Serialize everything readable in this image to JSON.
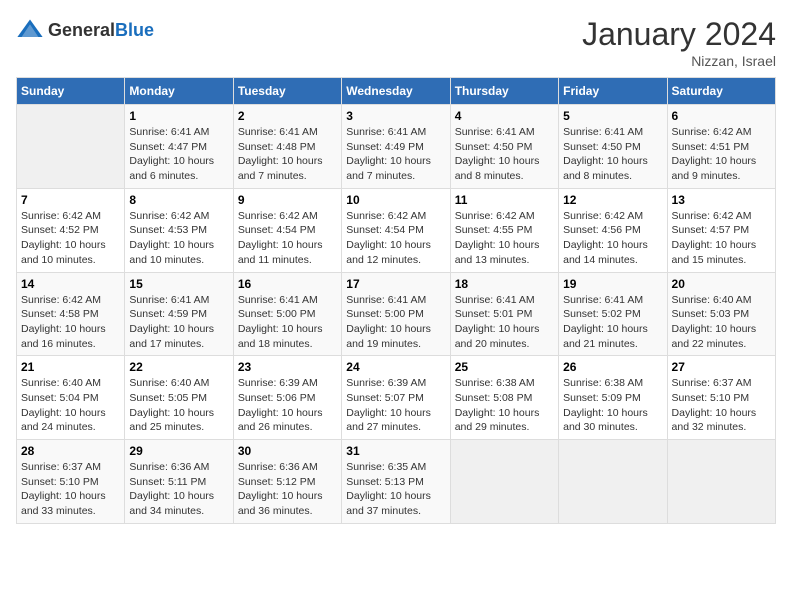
{
  "header": {
    "logo_general": "General",
    "logo_blue": "Blue",
    "month_title": "January 2024",
    "location": "Nizzan, Israel"
  },
  "days_of_week": [
    "Sunday",
    "Monday",
    "Tuesday",
    "Wednesday",
    "Thursday",
    "Friday",
    "Saturday"
  ],
  "weeks": [
    [
      {
        "day": "",
        "info": ""
      },
      {
        "day": "1",
        "info": "Sunrise: 6:41 AM\nSunset: 4:47 PM\nDaylight: 10 hours\nand 6 minutes."
      },
      {
        "day": "2",
        "info": "Sunrise: 6:41 AM\nSunset: 4:48 PM\nDaylight: 10 hours\nand 7 minutes."
      },
      {
        "day": "3",
        "info": "Sunrise: 6:41 AM\nSunset: 4:49 PM\nDaylight: 10 hours\nand 7 minutes."
      },
      {
        "day": "4",
        "info": "Sunrise: 6:41 AM\nSunset: 4:50 PM\nDaylight: 10 hours\nand 8 minutes."
      },
      {
        "day": "5",
        "info": "Sunrise: 6:41 AM\nSunset: 4:50 PM\nDaylight: 10 hours\nand 8 minutes."
      },
      {
        "day": "6",
        "info": "Sunrise: 6:42 AM\nSunset: 4:51 PM\nDaylight: 10 hours\nand 9 minutes."
      }
    ],
    [
      {
        "day": "7",
        "info": "Sunrise: 6:42 AM\nSunset: 4:52 PM\nDaylight: 10 hours\nand 10 minutes."
      },
      {
        "day": "8",
        "info": "Sunrise: 6:42 AM\nSunset: 4:53 PM\nDaylight: 10 hours\nand 10 minutes."
      },
      {
        "day": "9",
        "info": "Sunrise: 6:42 AM\nSunset: 4:54 PM\nDaylight: 10 hours\nand 11 minutes."
      },
      {
        "day": "10",
        "info": "Sunrise: 6:42 AM\nSunset: 4:54 PM\nDaylight: 10 hours\nand 12 minutes."
      },
      {
        "day": "11",
        "info": "Sunrise: 6:42 AM\nSunset: 4:55 PM\nDaylight: 10 hours\nand 13 minutes."
      },
      {
        "day": "12",
        "info": "Sunrise: 6:42 AM\nSunset: 4:56 PM\nDaylight: 10 hours\nand 14 minutes."
      },
      {
        "day": "13",
        "info": "Sunrise: 6:42 AM\nSunset: 4:57 PM\nDaylight: 10 hours\nand 15 minutes."
      }
    ],
    [
      {
        "day": "14",
        "info": "Sunrise: 6:42 AM\nSunset: 4:58 PM\nDaylight: 10 hours\nand 16 minutes."
      },
      {
        "day": "15",
        "info": "Sunrise: 6:41 AM\nSunset: 4:59 PM\nDaylight: 10 hours\nand 17 minutes."
      },
      {
        "day": "16",
        "info": "Sunrise: 6:41 AM\nSunset: 5:00 PM\nDaylight: 10 hours\nand 18 minutes."
      },
      {
        "day": "17",
        "info": "Sunrise: 6:41 AM\nSunset: 5:00 PM\nDaylight: 10 hours\nand 19 minutes."
      },
      {
        "day": "18",
        "info": "Sunrise: 6:41 AM\nSunset: 5:01 PM\nDaylight: 10 hours\nand 20 minutes."
      },
      {
        "day": "19",
        "info": "Sunrise: 6:41 AM\nSunset: 5:02 PM\nDaylight: 10 hours\nand 21 minutes."
      },
      {
        "day": "20",
        "info": "Sunrise: 6:40 AM\nSunset: 5:03 PM\nDaylight: 10 hours\nand 22 minutes."
      }
    ],
    [
      {
        "day": "21",
        "info": "Sunrise: 6:40 AM\nSunset: 5:04 PM\nDaylight: 10 hours\nand 24 minutes."
      },
      {
        "day": "22",
        "info": "Sunrise: 6:40 AM\nSunset: 5:05 PM\nDaylight: 10 hours\nand 25 minutes."
      },
      {
        "day": "23",
        "info": "Sunrise: 6:39 AM\nSunset: 5:06 PM\nDaylight: 10 hours\nand 26 minutes."
      },
      {
        "day": "24",
        "info": "Sunrise: 6:39 AM\nSunset: 5:07 PM\nDaylight: 10 hours\nand 27 minutes."
      },
      {
        "day": "25",
        "info": "Sunrise: 6:38 AM\nSunset: 5:08 PM\nDaylight: 10 hours\nand 29 minutes."
      },
      {
        "day": "26",
        "info": "Sunrise: 6:38 AM\nSunset: 5:09 PM\nDaylight: 10 hours\nand 30 minutes."
      },
      {
        "day": "27",
        "info": "Sunrise: 6:37 AM\nSunset: 5:10 PM\nDaylight: 10 hours\nand 32 minutes."
      }
    ],
    [
      {
        "day": "28",
        "info": "Sunrise: 6:37 AM\nSunset: 5:10 PM\nDaylight: 10 hours\nand 33 minutes."
      },
      {
        "day": "29",
        "info": "Sunrise: 6:36 AM\nSunset: 5:11 PM\nDaylight: 10 hours\nand 34 minutes."
      },
      {
        "day": "30",
        "info": "Sunrise: 6:36 AM\nSunset: 5:12 PM\nDaylight: 10 hours\nand 36 minutes."
      },
      {
        "day": "31",
        "info": "Sunrise: 6:35 AM\nSunset: 5:13 PM\nDaylight: 10 hours\nand 37 minutes."
      },
      {
        "day": "",
        "info": ""
      },
      {
        "day": "",
        "info": ""
      },
      {
        "day": "",
        "info": ""
      }
    ]
  ]
}
